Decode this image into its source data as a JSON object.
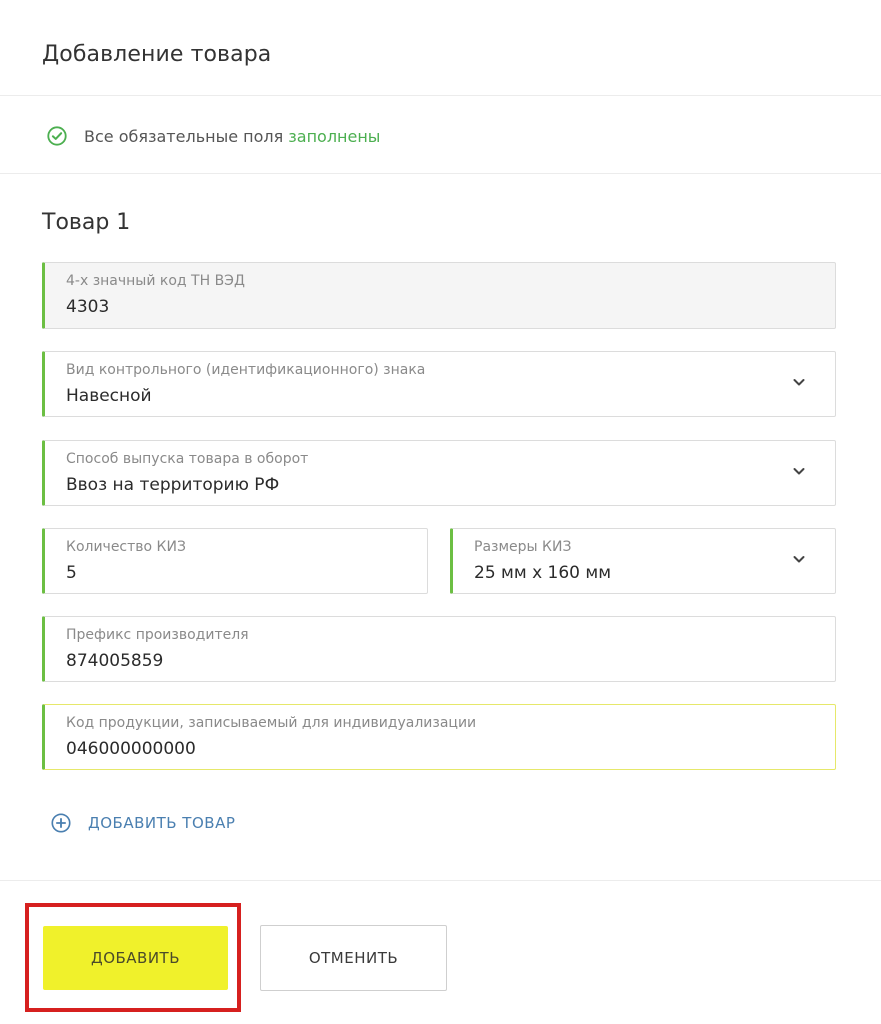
{
  "header": {
    "title": "Добавление товара"
  },
  "status": {
    "text": "Все обязательные поля",
    "accent": "заполнены",
    "accent_color": "#4caf50"
  },
  "product": {
    "title": "Товар 1",
    "fields": {
      "tnved": {
        "label": "4-х значный код ТН ВЭД",
        "value": "4303"
      },
      "sign_type": {
        "label": "Вид контрольного (идентификационного) знака",
        "value": "Навесной"
      },
      "release_method": {
        "label": "Способ выпуска товара в оборот",
        "value": "Ввоз на территорию РФ"
      },
      "kiz_count": {
        "label": "Количество КИЗ",
        "value": "5"
      },
      "kiz_size": {
        "label": "Размеры КИЗ",
        "value": "25 мм x 160 мм"
      },
      "manufacturer_prefix": {
        "label": "Префикс производителя",
        "value": "874005859"
      },
      "product_code": {
        "label": "Код продукции, записываемый для индивидуализации",
        "value": "046000000000"
      }
    }
  },
  "actions": {
    "add_product": "ДОБАВИТЬ ТОВАР",
    "submit": "ДОБАВИТЬ",
    "cancel": "ОТМЕНИТЬ"
  },
  "colors": {
    "field_accent": "#6cbf43",
    "primary_button": "#f0f12b",
    "highlight_frame": "#d6201f",
    "link": "#4a7fb0"
  }
}
